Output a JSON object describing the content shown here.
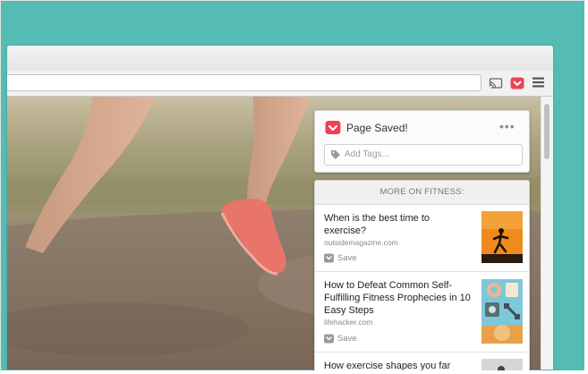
{
  "pocket": {
    "saved_title": "Page Saved!",
    "more_label": "•••",
    "tags_placeholder": "Add Tags...",
    "more_header": "MORE ON FITNESS:",
    "articles": [
      {
        "title": "When is the best time to exercise?",
        "source": "outsidemagazine.com",
        "save_label": "Save"
      },
      {
        "title": "How to Defeat Common Self-Fulfilling Fitness Prophecies in 10 Easy Steps",
        "source": "lifehacker.com",
        "save_label": "Save"
      },
      {
        "title": "How exercise shapes you far",
        "source": "",
        "save_label": ""
      }
    ]
  },
  "colors": {
    "frame_teal": "#56bdb4",
    "pocket_red": "#ef4056",
    "thumb_orange": "#f08a1c",
    "thumb_blue": "#7ec7d8"
  },
  "icons": {
    "cast": "cast-icon",
    "pocket": "pocket-icon",
    "menu": "hamburger-menu-icon",
    "tag": "tag-icon",
    "save": "pocket-save-icon"
  }
}
